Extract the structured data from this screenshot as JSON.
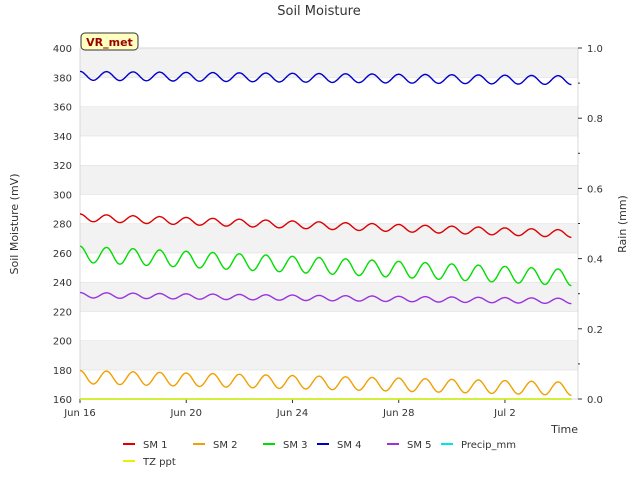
{
  "chart_data": {
    "type": "line",
    "title": "Soil Moisture",
    "badge": "VR_met",
    "xlabel": "Time",
    "ylabel": "Soil Moisture (mV)",
    "y2label": "Rain (mm)",
    "xlim": [
      "2024-06-16",
      "2024-07-04T18:00"
    ],
    "ylim": [
      160,
      400
    ],
    "y2lim": [
      0,
      1.0
    ],
    "grid": "horizontal bands",
    "legend_position": "bottom",
    "x_ticks": [
      {
        "date": "2024-06-16",
        "label": "Jun 16"
      },
      {
        "date": "2024-06-20",
        "label": "Jun 20"
      },
      {
        "date": "2024-06-24",
        "label": "Jun 24"
      },
      {
        "date": "2024-06-28",
        "label": "Jun 28"
      },
      {
        "date": "2024-07-02",
        "label": "Jul 2"
      }
    ],
    "y_ticks": [
      "160",
      "180",
      "200",
      "220",
      "240",
      "260",
      "280",
      "300",
      "320",
      "340",
      "360",
      "380",
      "400"
    ],
    "y2_ticks": [
      "0.0",
      "0.2",
      "0.4",
      "0.6",
      "0.8",
      "1.0"
    ],
    "series": [
      {
        "name": "SM 1",
        "color": "#dd0000",
        "start_date": "2024-06-16",
        "end_date": "2024-07-04",
        "start_level": 284,
        "end_level": 273,
        "daily_amplitude": 2.5,
        "axis": "left"
      },
      {
        "name": "SM 2",
        "color": "#f0a000",
        "start_date": "2024-06-16",
        "end_date": "2024-07-04",
        "start_level": 175,
        "end_level": 167,
        "daily_amplitude": 4.5,
        "axis": "left"
      },
      {
        "name": "SM 3",
        "color": "#00dd00",
        "start_date": "2024-06-16",
        "end_date": "2024-07-04",
        "start_level": 259,
        "end_level": 243,
        "daily_amplitude": 5.5,
        "axis": "left"
      },
      {
        "name": "SM 4",
        "color": "#0000cc",
        "start_date": "2024-06-16",
        "end_date": "2024-07-04",
        "start_level": 381,
        "end_level": 378,
        "daily_amplitude": 3.0,
        "axis": "left"
      },
      {
        "name": "SM 5",
        "color": "#9933dd",
        "start_date": "2024-06-16",
        "end_date": "2024-07-04",
        "start_level": 231,
        "end_level": 227,
        "daily_amplitude": 1.8,
        "axis": "left"
      },
      {
        "name": "Precip_mm",
        "color": "#00e5e5",
        "start_date": "2024-06-16",
        "end_date": "2024-07-04",
        "start_level": 0,
        "end_level": 0,
        "daily_amplitude": 0,
        "axis": "right"
      },
      {
        "name": "TZ ppt",
        "color": "#eeee00",
        "start_date": "2024-06-16",
        "end_date": "2024-07-04",
        "start_level": 160,
        "end_level": 160,
        "daily_amplitude": 0,
        "axis": "left"
      }
    ]
  }
}
